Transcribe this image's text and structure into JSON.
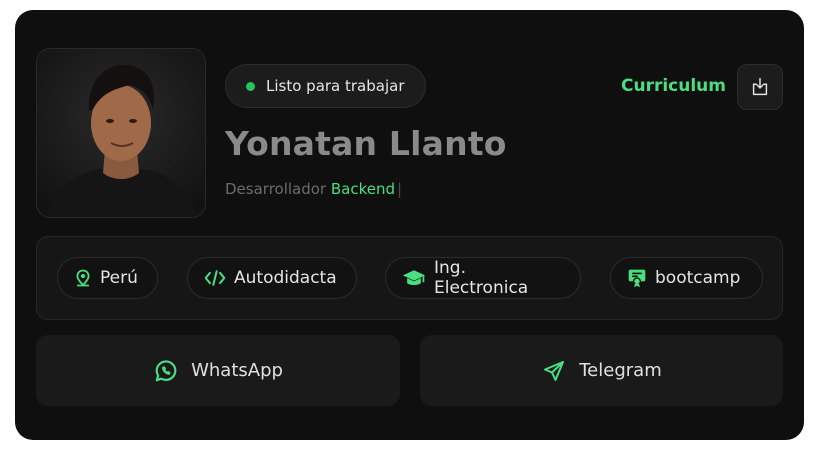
{
  "profile": {
    "status": "Listo para trabajar",
    "name": "Yonatan Llanto",
    "role_prefix": "Desarrollador",
    "role_highlight": "Backend",
    "role_caret": "|",
    "cv_label": "Curriculum"
  },
  "tags": [
    {
      "label": "Perú",
      "icon": "map-pin-icon"
    },
    {
      "label": "Autodidacta",
      "icon": "code-icon"
    },
    {
      "label": "Ing. Electronica",
      "icon": "graduation-cap-icon"
    },
    {
      "label": "bootcamp",
      "icon": "certificate-icon"
    }
  ],
  "actions": {
    "whatsapp": "WhatsApp",
    "telegram": "Telegram"
  },
  "colors": {
    "accent": "#4ade80",
    "status_dot": "#22c55e",
    "card_bg": "#0f0f0f"
  }
}
